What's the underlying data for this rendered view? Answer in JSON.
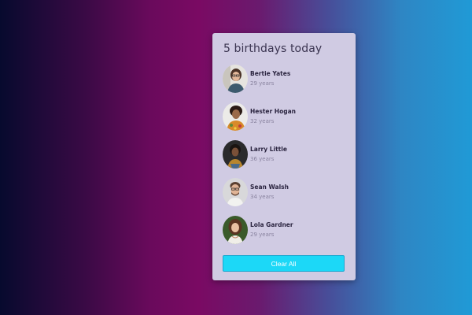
{
  "card": {
    "title": "5 birthdays today",
    "clear_label": "Clear All"
  },
  "people": [
    {
      "name": "Bertie Yates",
      "age": "29 years"
    },
    {
      "name": "Hester Hogan",
      "age": "32 years"
    },
    {
      "name": "Larry Little",
      "age": "36 years"
    },
    {
      "name": "Sean Walsh",
      "age": "34 years"
    },
    {
      "name": "Lola Gardner",
      "age": "29 years"
    }
  ],
  "colors": {
    "card_bg": "#d0cbe3",
    "button_bg": "#1cd8f7",
    "title_text": "#3a3450"
  }
}
